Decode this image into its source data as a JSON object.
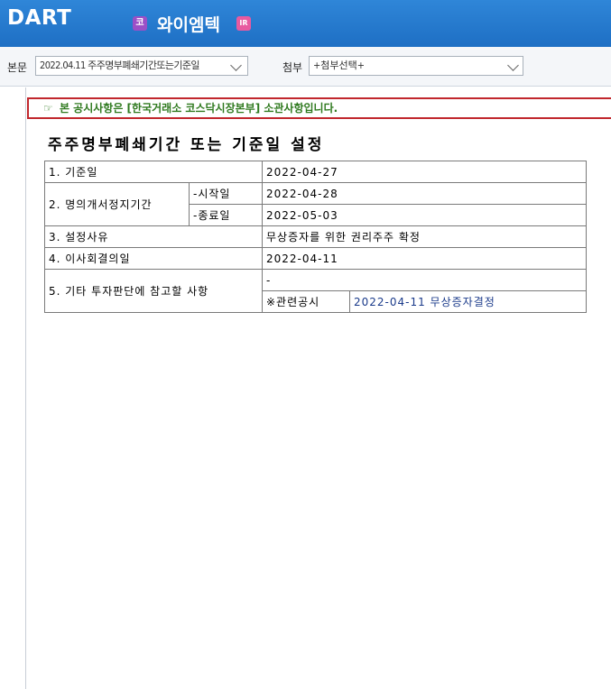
{
  "header": {
    "logo_text": "DART",
    "badge_left": "코",
    "company": "와이엠텍",
    "badge_right": "IR"
  },
  "toolbar": {
    "body_label": "본문",
    "body_value": "2022.04.11  주주명부폐쇄기간또는기준일",
    "attach_label": "첨부",
    "attach_value": "+첨부선택+"
  },
  "notice": {
    "icon": "☞",
    "text": "본 공시사항은 [한국거래소 코스닥시장본부] 소관사항입니다."
  },
  "document": {
    "title": "주주명부폐쇄기간 또는 기준일 설정",
    "rows": {
      "r1_label": "1. 기준일",
      "r1_value": "2022-04-27",
      "r2_label": "2. 명의개서정지기간",
      "r2_start_label": "-시작일",
      "r2_start_value": "2022-04-28",
      "r2_end_label": "-종료일",
      "r2_end_value": "2022-05-03",
      "r3_label": "3. 설정사유",
      "r3_value": "무상증자를 위한 권리주주 확정",
      "r4_label": "4. 이사회결의일",
      "r4_value": "2022-04-11",
      "r5_label": "5. 기타 투자판단에 참고할 사항",
      "r5_value": "-",
      "related_label": "※관련공시",
      "related_link": "2022-04-11 무상증자결정"
    }
  }
}
